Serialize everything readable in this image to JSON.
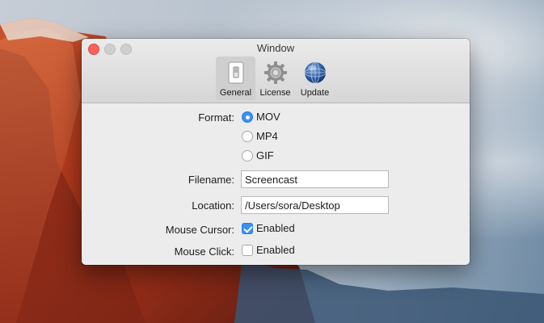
{
  "window": {
    "title": "Window",
    "controls": [
      "close",
      "minimize",
      "maximize"
    ]
  },
  "toolbar": {
    "items": [
      {
        "label": "General",
        "icon": "switch-icon",
        "selected": true
      },
      {
        "label": "License",
        "icon": "gear-icon",
        "selected": false
      },
      {
        "label": "Update",
        "icon": "globe-icon",
        "selected": false
      }
    ]
  },
  "form": {
    "format": {
      "label": "Format:",
      "options": [
        "MOV",
        "MP4",
        "GIF"
      ],
      "selected": "MOV"
    },
    "filename": {
      "label": "Filename:",
      "value": "Screencast"
    },
    "location": {
      "label": "Location:",
      "value": "/Users/sora/Desktop"
    },
    "mouse_cursor": {
      "label": "Mouse Cursor:",
      "option": "Enabled",
      "checked": true
    },
    "mouse_click": {
      "label": "Mouse Click:",
      "option": "Enabled",
      "checked": false
    }
  },
  "colors": {
    "accent": "#3b8ff6",
    "close_button": "#fc605c"
  }
}
